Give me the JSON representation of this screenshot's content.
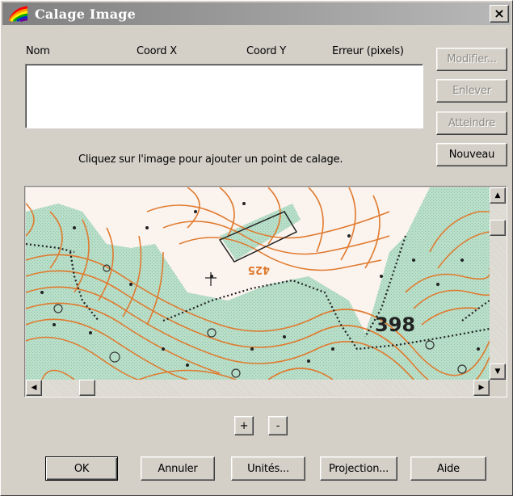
{
  "window": {
    "title": "Calage Image",
    "close_label": "×"
  },
  "list": {
    "columns": [
      "Nom",
      "Coord X",
      "Coord Y",
      "Erreur (pixels)"
    ],
    "rows": []
  },
  "side_buttons": {
    "modifier": "Modifier...",
    "enlever": "Enlever",
    "atteindre": "Atteindre",
    "nouveau": "Nouveau"
  },
  "hint": "Cliquez sur l'image pour ajouter un point de calage.",
  "map": {
    "elevation_label": "398",
    "contour_label": "425",
    "colors": {
      "forest": "#b9dec9",
      "contour": "#e07a2e",
      "paper": "#fbf3ee"
    }
  },
  "zoom": {
    "in_label": "+",
    "out_label": "-"
  },
  "footer": {
    "ok": "OK",
    "annuler": "Annuler",
    "unites": "Unités...",
    "projection": "Projection...",
    "aide": "Aide"
  },
  "icons": {
    "app": "app-rainbow-icon",
    "scroll_up": "arrow-up-icon",
    "scroll_down": "arrow-down-icon",
    "scroll_left": "arrow-left-icon",
    "scroll_right": "arrow-right-icon"
  }
}
